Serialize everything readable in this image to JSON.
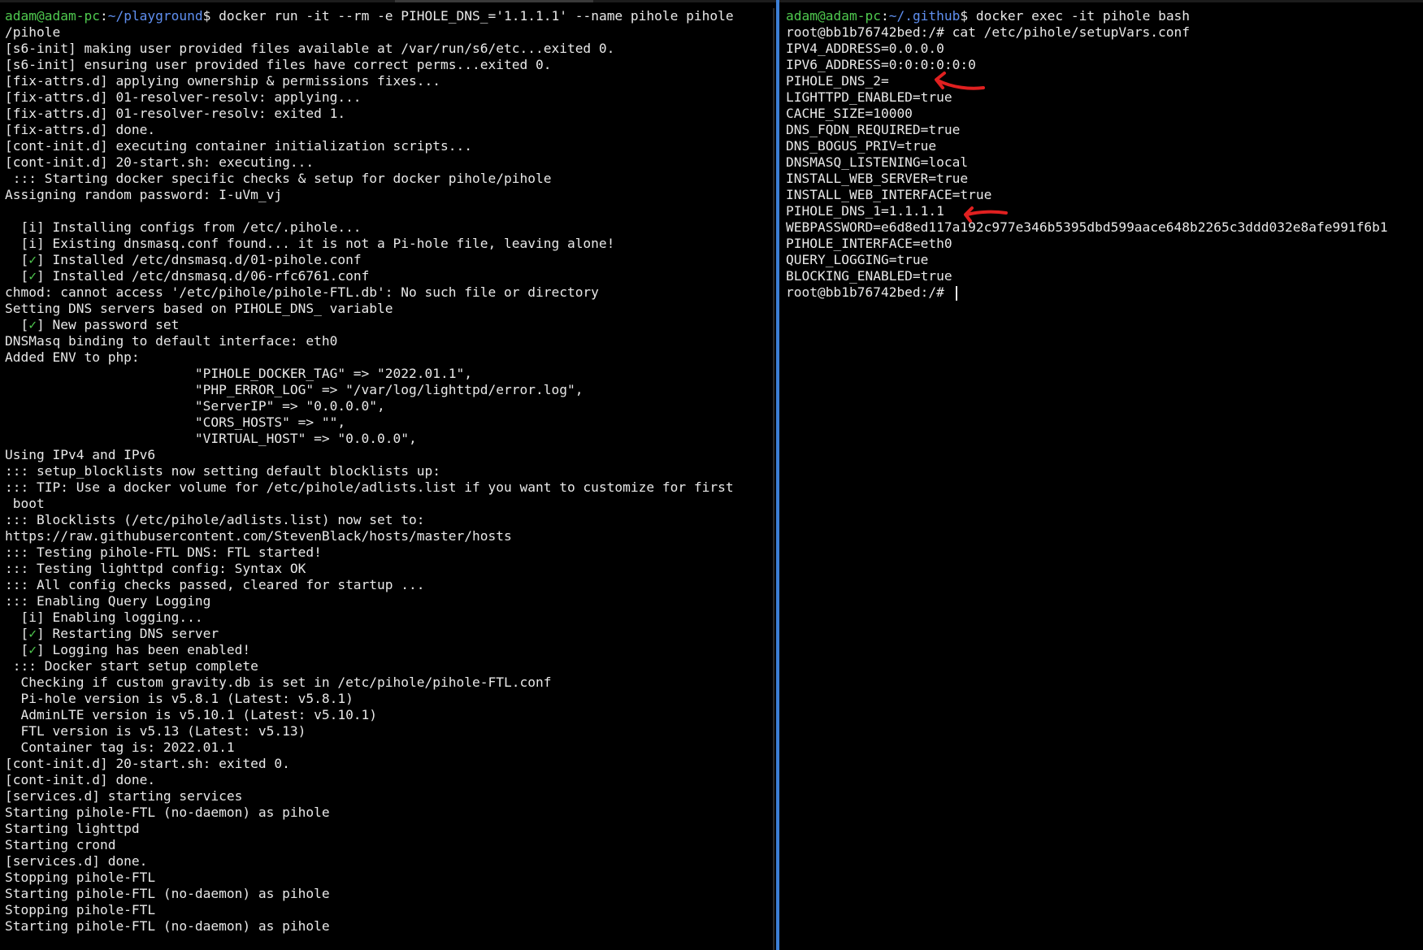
{
  "left_terminal": {
    "prompt": {
      "user_host": "adam@adam-pc",
      "separator": ":",
      "path": "~/playground",
      "symbol": "$",
      "command": " docker run -it --rm -e PIHOLE_DNS_='1.1.1.1' --name pihole pihole"
    },
    "output": [
      "/pihole",
      "[s6-init] making user provided files available at /var/run/s6/etc...exited 0.",
      "[s6-init] ensuring user provided files have correct perms...exited 0.",
      "[fix-attrs.d] applying ownership & permissions fixes...",
      "[fix-attrs.d] 01-resolver-resolv: applying...",
      "[fix-attrs.d] 01-resolver-resolv: exited 1.",
      "[fix-attrs.d] done.",
      "[cont-init.d] executing container initialization scripts...",
      "[cont-init.d] 20-start.sh: executing...",
      " ::: Starting docker specific checks & setup for docker pihole/pihole",
      "Assigning random password: I-uVm_vj",
      "",
      "  [i] Installing configs from /etc/.pihole...",
      "  [i] Existing dnsmasq.conf found... it is not a Pi-hole file, leaving alone!",
      "  [✓] Installed /etc/dnsmasq.d/01-pihole.conf",
      "  [✓] Installed /etc/dnsmasq.d/06-rfc6761.conf",
      "chmod: cannot access '/etc/pihole/pihole-FTL.db': No such file or directory",
      "Setting DNS servers based on PIHOLE_DNS_ variable",
      "  [✓] New password set",
      "DNSMasq binding to default interface: eth0",
      "Added ENV to php:",
      "                        \"PIHOLE_DOCKER_TAG\" => \"2022.01.1\",",
      "                        \"PHP_ERROR_LOG\" => \"/var/log/lighttpd/error.log\",",
      "                        \"ServerIP\" => \"0.0.0.0\",",
      "                        \"CORS_HOSTS\" => \"\",",
      "                        \"VIRTUAL_HOST\" => \"0.0.0.0\",",
      "Using IPv4 and IPv6",
      "::: setup_blocklists now setting default blocklists up:",
      "::: TIP: Use a docker volume for /etc/pihole/adlists.list if you want to customize for first",
      " boot",
      "::: Blocklists (/etc/pihole/adlists.list) now set to:",
      "https://raw.githubusercontent.com/StevenBlack/hosts/master/hosts",
      "::: Testing pihole-FTL DNS: FTL started!",
      "::: Testing lighttpd config: Syntax OK",
      "::: All config checks passed, cleared for startup ...",
      "::: Enabling Query Logging",
      "  [i] Enabling logging...",
      "  [✓] Restarting DNS server",
      "  [✓] Logging has been enabled!",
      " ::: Docker start setup complete",
      "  Checking if custom gravity.db is set in /etc/pihole/pihole-FTL.conf",
      "  Pi-hole version is v5.8.1 (Latest: v5.8.1)",
      "  AdminLTE version is v5.10.1 (Latest: v5.10.1)",
      "  FTL version is v5.13 (Latest: v5.13)",
      "  Container tag is: 2022.01.1",
      "[cont-init.d] 20-start.sh: exited 0.",
      "[cont-init.d] done.",
      "[services.d] starting services",
      "Starting pihole-FTL (no-daemon) as pihole",
      "Starting lighttpd",
      "Starting crond",
      "[services.d] done.",
      "Stopping pihole-FTL",
      "Starting pihole-FTL (no-daemon) as pihole",
      "Stopping pihole-FTL",
      "Starting pihole-FTL (no-daemon) as pihole"
    ]
  },
  "right_terminal": {
    "prompt": {
      "user_host": "adam@adam-pc",
      "separator": ":",
      "path": "~/.github",
      "symbol": "$",
      "command": " docker exec -it pihole bash"
    },
    "output": [
      "root@bb1b76742bed:/# cat /etc/pihole/setupVars.conf",
      "IPV4_ADDRESS=0.0.0.0",
      "IPV6_ADDRESS=0:0:0:0:0:0",
      "PIHOLE_DNS_2=",
      "LIGHTTPD_ENABLED=true",
      "CACHE_SIZE=10000",
      "DNS_FQDN_REQUIRED=true",
      "DNS_BOGUS_PRIV=true",
      "DNSMASQ_LISTENING=local",
      "INSTALL_WEB_SERVER=true",
      "INSTALL_WEB_INTERFACE=true",
      "PIHOLE_DNS_1=1.1.1.1",
      "WEBPASSWORD=e6d8ed117a192c977e346b5395dbd599aace648b2265c3ddd032e8afe991f6b1",
      "PIHOLE_INTERFACE=eth0",
      "QUERY_LOGGING=true",
      "BLOCKING_ENABLED=true"
    ],
    "current_prompt": "root@bb1b76742bed:/# "
  },
  "annotations": [
    {
      "name": "red-arrow-pihole-dns-2",
      "points_to_line": "PIHOLE_DNS_2=",
      "color": "#e02020"
    },
    {
      "name": "red-arrow-pihole-dns-1",
      "points_to_line": "PIHOLE_DNS_1=1.1.1.1",
      "color": "#e02020"
    }
  ],
  "colors": {
    "background": "#000000",
    "text": "#e8e8e8",
    "prompt_user": "#4fc94f",
    "prompt_path": "#5f8ff0",
    "check_mark": "#4fc94f",
    "pane_divider": "#3d7fd4",
    "annotation": "#e02020"
  }
}
